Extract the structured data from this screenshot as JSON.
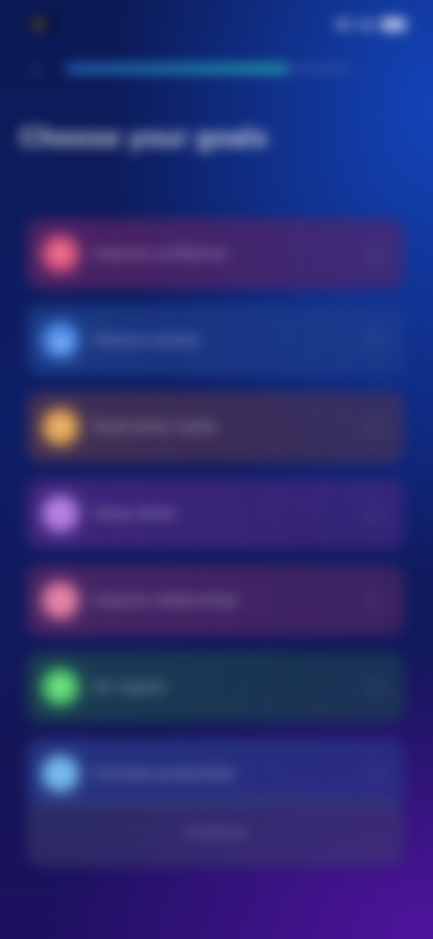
{
  "status_bar": {
    "time": "",
    "accent_color": "#a57a3a"
  },
  "header": {
    "back_icon": "chevron-left-icon",
    "progress_fraction": 0.78
  },
  "page_title": "Choose your goals",
  "options": [
    {
      "label": "Improve confidence",
      "icon": "heart-icon",
      "color": "#e0567e",
      "bg": "#5a2466"
    },
    {
      "label": "Reduce anxiety",
      "icon": "cloud-icon",
      "color": "#4f8ee8",
      "bg": "#1f3f8c"
    },
    {
      "label": "Build better habits",
      "icon": "star-icon",
      "color": "#e0a24f",
      "bg": "#4f3450"
    },
    {
      "label": "Sleep better",
      "icon": "moon-icon",
      "color": "#b07ae0",
      "bg": "#4a2880"
    },
    {
      "label": "Improve relationships",
      "icon": "people-icon",
      "color": "#e07aa0",
      "bg": "#562866"
    },
    {
      "label": "Be happier",
      "icon": "leaf-icon",
      "color": "#4fd06a",
      "bg": "#1c4450"
    },
    {
      "label": "Increase productivity",
      "icon": "bolt-icon",
      "color": "#6fb6e8",
      "bg": "#2a3a8a"
    }
  ],
  "continue_label": "Continue",
  "colors": {
    "background_top": "#0c1a55",
    "background_bottom": "#1e1060",
    "progress_start": "#2a7ad6",
    "progress_end": "#26c2b4"
  }
}
